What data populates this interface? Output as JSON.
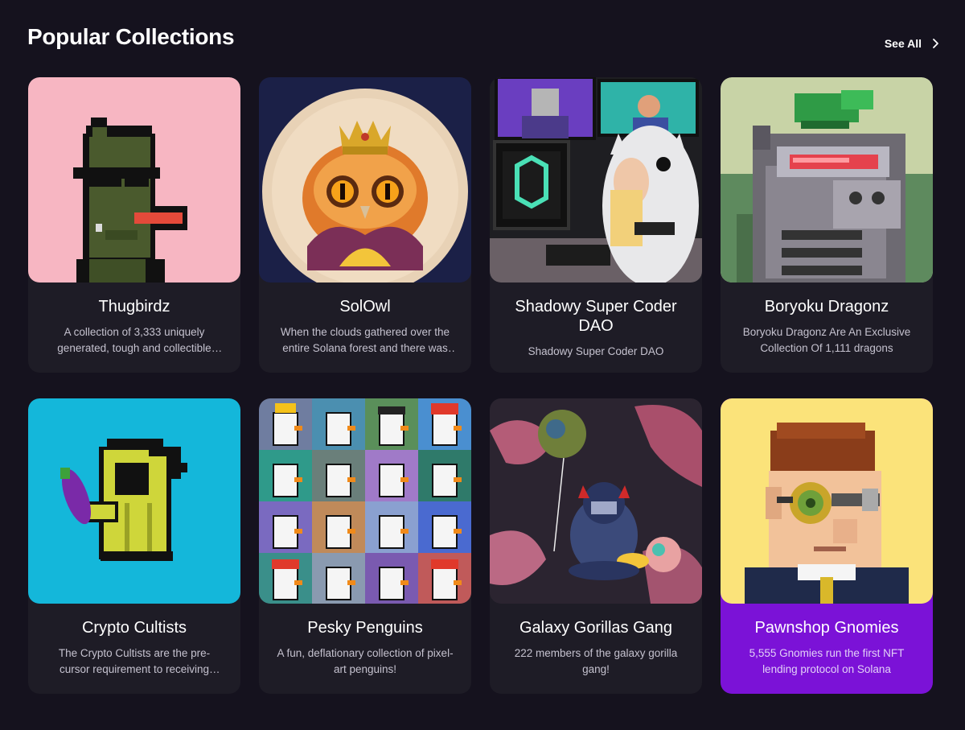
{
  "section": {
    "title": "Popular Collections",
    "see_all_label": "See All",
    "see_all_icon": "chevron-right-icon"
  },
  "colors": {
    "background": "#15121e",
    "card": "#1e1c26",
    "highlight_card": "#7b12d7"
  },
  "collections": [
    {
      "title": "Thugbirdz",
      "description": "A collection of 3,333 uniquely generated, tough and collectible birds",
      "highlighted": false
    },
    {
      "title": "SolOwl",
      "description": "When the clouds gathered over the entire Solana forest and there was darkness",
      "highlighted": false
    },
    {
      "title": "Shadowy Super Coder DAO",
      "description": "Shadowy Super Coder DAO",
      "highlighted": false
    },
    {
      "title": "Boryoku Dragonz",
      "description": "Boryoku Dragonz Are An Exclusive Collection Of 1,111 dragons",
      "highlighted": false
    },
    {
      "title": "Crypto Cultists",
      "description": "The Crypto Cultists are the pre-cursor requirement to receiving access",
      "highlighted": false
    },
    {
      "title": "Pesky Penguins",
      "description": "A fun, deflationary collection of pixel-art penguins!",
      "highlighted": false
    },
    {
      "title": "Galaxy Gorillas Gang",
      "description": "222 members of the galaxy gorilla gang!",
      "highlighted": false
    },
    {
      "title": "Pawnshop Gnomies",
      "description": "5,555 Gnomies run the first NFT lending protocol on Solana",
      "highlighted": true
    }
  ]
}
